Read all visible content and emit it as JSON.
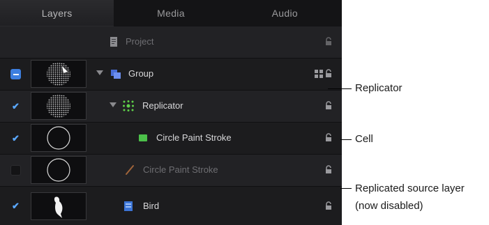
{
  "tabs": [
    "Layers",
    "Media",
    "Audio"
  ],
  "layers": [
    {
      "name": "Project"
    },
    {
      "name": "Group"
    },
    {
      "name": "Replicator"
    },
    {
      "name": "Circle Paint Stroke"
    },
    {
      "name": "Circle Paint Stroke"
    },
    {
      "name": "Bird"
    }
  ],
  "callouts": {
    "replicator": "Replicator",
    "cell": "Cell",
    "source_line1": "Replicated source layer",
    "source_line2": "(now disabled)"
  },
  "colors": {
    "panel_bg": "#1c1c1e",
    "checkbox_accent": "#3d7fe0",
    "text": "#d8d8da",
    "dim_text": "#6e6e72"
  },
  "icons": {
    "project": "project-document-icon",
    "group": "group-stack-icon",
    "replicator": "replicator-icon",
    "cell": "cell-square-icon",
    "paint_stroke": "paint-stroke-icon",
    "bird": "bird-image-icon",
    "lock": "lock-icon"
  }
}
